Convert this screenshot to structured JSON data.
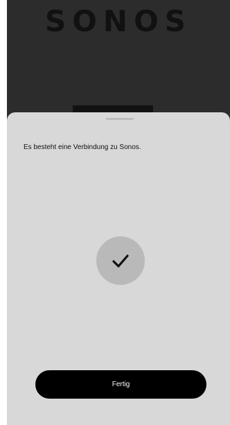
{
  "app": {
    "brand": "SONOS"
  },
  "sheet": {
    "message": "Es besteht eine Verbindung zu Sonos.",
    "status_icon": "checkmark-icon",
    "done_label": "Fertig"
  },
  "colors": {
    "backdrop": "#2c2c2c",
    "sheet": "#d8d8d8",
    "check_circle": "#b9b9b9",
    "button": "#000000",
    "button_text": "#ffffff"
  }
}
